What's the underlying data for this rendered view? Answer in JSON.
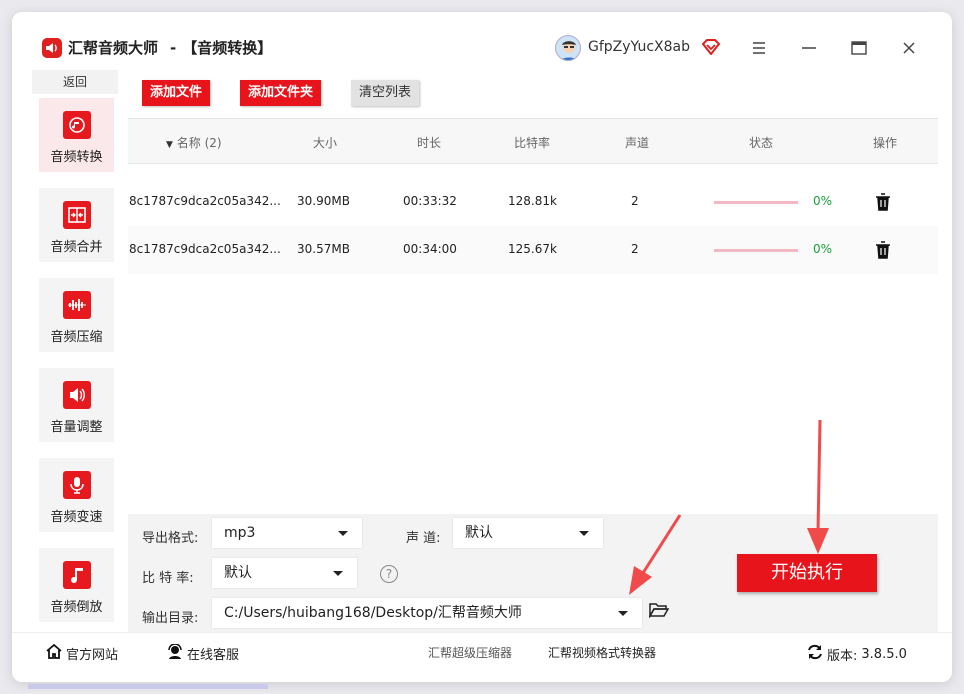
{
  "app": {
    "name": "汇帮音频大师",
    "separator": "-",
    "module": "【音频转换】",
    "username": "GfpZyYucX8ab"
  },
  "sidebar": {
    "back_label": "返回",
    "items": [
      {
        "label": "音频转换",
        "icon": "audio-convert-icon"
      },
      {
        "label": "音频合并",
        "icon": "audio-merge-icon"
      },
      {
        "label": "音频压缩",
        "icon": "audio-compress-icon"
      },
      {
        "label": "音量调整",
        "icon": "volume-icon"
      },
      {
        "label": "音频变速",
        "icon": "microphone-icon"
      },
      {
        "label": "音频倒放",
        "icon": "music-note-icon"
      }
    ]
  },
  "toolbar": {
    "add_file": "添加文件",
    "add_folder": "添加文件夹",
    "clear_list": "清空列表"
  },
  "table": {
    "columns": {
      "name": "名称 (2)",
      "size": "大小",
      "duration": "时长",
      "bitrate": "比特率",
      "channels": "声道",
      "status": "状态",
      "action": "操作"
    },
    "rows": [
      {
        "name": "8c1787c9dca2c05a342...",
        "size": "30.90MB",
        "duration": "00:33:32",
        "bitrate": "128.81k",
        "channels": "2",
        "progress": "0%"
      },
      {
        "name": "8c1787c9dca2c05a342...",
        "size": "30.57MB",
        "duration": "00:34:00",
        "bitrate": "125.67k",
        "channels": "2",
        "progress": "0%"
      }
    ]
  },
  "settings": {
    "format_label": "导出格式:",
    "format_value": "mp3",
    "channel_label": "声 道:",
    "channel_value": "默认",
    "bitrate_label": "比 特 率:",
    "bitrate_value": "默认",
    "help": "?",
    "output_label": "输出目录:",
    "output_value": "C:/Users/huibang168/Desktop/汇帮音频大师"
  },
  "start_button": "开始执行",
  "footer": {
    "website": "官方网站",
    "support": "在线客服",
    "compressor": "汇帮超级压缩器",
    "video_converter": "汇帮视频格式转换器",
    "version_label": "版本:",
    "version": "3.8.5.0"
  },
  "colors": {
    "accent": "#e8141b",
    "progress_track": "#f4b7c4",
    "progress_text": "#1aa13a"
  }
}
